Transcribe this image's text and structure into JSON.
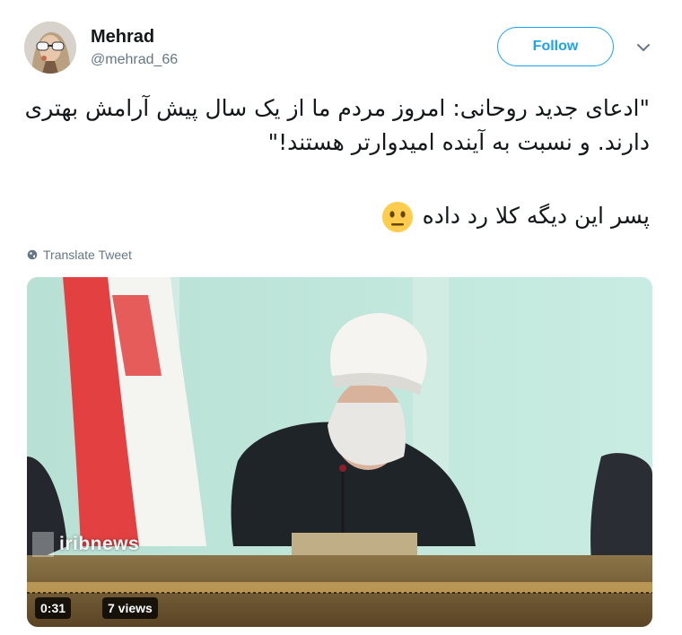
{
  "user": {
    "name": "Mehrad",
    "handle": "@mehrad_66"
  },
  "actions": {
    "follow_label": "Follow",
    "translate_label": "Translate Tweet"
  },
  "tweet": {
    "line1": "\"ادعای جدید روحانی: امروز مردم ما از یک سال پیش آرامش بهتری دارند. و نسبت به آینده امیدوارتر هستند!\"",
    "line2": "پسر این دیگه کلا رد داده"
  },
  "media": {
    "watermark": "iribnews",
    "duration": "0:31",
    "views": "7 views"
  },
  "colors": {
    "accent": "#1da1f2",
    "secondary_text": "#657786"
  },
  "icons": {
    "globe": "globe-icon",
    "caret": "chevron-down-icon",
    "emoji": "neutral-face-icon"
  }
}
